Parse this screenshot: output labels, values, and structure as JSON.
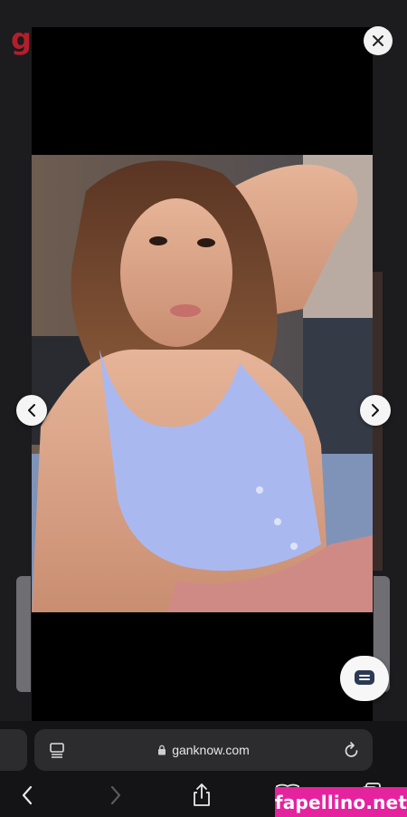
{
  "site": {
    "logo_letter": "g"
  },
  "lightbox": {
    "close_label": "✕",
    "prev_label": "‹",
    "next_label": "›"
  },
  "browser": {
    "url": "ganknow.com"
  },
  "watermark": "fapellino.net",
  "colors": {
    "accent": "#b21f2b",
    "watermark_bg": "#e5239e",
    "top_color": "#a9b9f0"
  },
  "icons": [
    "close-icon",
    "chevron-left-icon",
    "chevron-right-icon",
    "chat-icon",
    "reader-icon",
    "lock-icon",
    "reload-icon",
    "back-icon",
    "forward-icon",
    "share-icon",
    "bookmarks-icon",
    "tabs-icon"
  ]
}
